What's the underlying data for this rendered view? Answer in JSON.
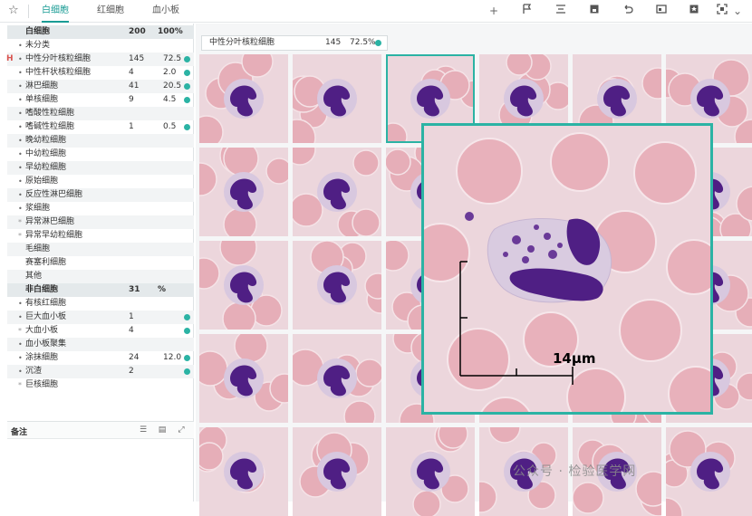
{
  "toolbar": {
    "tabs": [
      {
        "label": "白细胞",
        "active": true
      },
      {
        "label": "红细胞",
        "active": false
      },
      {
        "label": "血小板",
        "active": false
      }
    ],
    "icons": [
      "star-icon",
      "plus-icon",
      "flag-icon",
      "align-icon",
      "save-icon",
      "undo-icon",
      "gallery-icon",
      "bookmark-icon",
      "fit-icon",
      "chevron-down-icon"
    ]
  },
  "wbc_panel": {
    "header": {
      "label": "白细胞",
      "count": "200",
      "percent": "100%"
    },
    "items": [
      {
        "label": "未分类",
        "count": "",
        "percent": "",
        "dot": false,
        "star": false
      },
      {
        "label": "中性分叶核粒细胞",
        "count": "145",
        "percent": "72.5",
        "dot": true,
        "star": false,
        "flag": "H"
      },
      {
        "label": "中性杆状核粒细胞",
        "count": "4",
        "percent": "2.0",
        "dot": true,
        "star": false
      },
      {
        "label": "淋巴细胞",
        "count": "41",
        "percent": "20.5",
        "dot": true,
        "star": false
      },
      {
        "label": "单核细胞",
        "count": "9",
        "percent": "4.5",
        "dot": true,
        "star": false
      },
      {
        "label": "嗜酸性粒细胞",
        "count": "",
        "percent": "",
        "dot": false,
        "star": false
      },
      {
        "label": "嗜碱性粒细胞",
        "count": "1",
        "percent": "0.5",
        "dot": true,
        "star": false
      },
      {
        "label": "晚幼粒细胞",
        "count": "",
        "percent": "",
        "dot": false,
        "star": false
      },
      {
        "label": "中幼粒细胞",
        "count": "",
        "percent": "",
        "dot": false,
        "star": false
      },
      {
        "label": "早幼粒细胞",
        "count": "",
        "percent": "",
        "dot": false,
        "star": false
      },
      {
        "label": "原始细胞",
        "count": "",
        "percent": "",
        "dot": false,
        "star": false
      },
      {
        "label": "反应性淋巴细胞",
        "count": "",
        "percent": "",
        "dot": false,
        "star": false
      },
      {
        "label": "浆细胞",
        "count": "",
        "percent": "",
        "dot": false,
        "star": false
      },
      {
        "label": "异常淋巴细胞",
        "count": "",
        "percent": "",
        "dot": false,
        "star": true
      },
      {
        "label": "异常早幼粒细胞",
        "count": "",
        "percent": "",
        "dot": false,
        "star": true
      },
      {
        "label": "毛细胞",
        "count": "",
        "percent": "",
        "dot": false,
        "star": false,
        "nobullet": true
      },
      {
        "label": "赛塞利细胞",
        "count": "",
        "percent": "",
        "dot": false,
        "star": false,
        "nobullet": true
      },
      {
        "label": "其他",
        "count": "",
        "percent": "",
        "dot": false,
        "star": false,
        "nobullet": true
      }
    ]
  },
  "non_wbc_panel": {
    "header": {
      "label": "非白细胞",
      "count": "31",
      "percent": "%"
    },
    "items": [
      {
        "label": "有核红细胞",
        "count": "",
        "percent": "",
        "dot": false,
        "star": false
      },
      {
        "label": "巨大血小板",
        "count": "1",
        "percent": "",
        "dot": true,
        "star": false
      },
      {
        "label": "大血小板",
        "count": "4",
        "percent": "",
        "dot": true,
        "star": true
      },
      {
        "label": "血小板聚集",
        "count": "",
        "percent": "",
        "dot": false,
        "star": false
      },
      {
        "label": "涂抹细胞",
        "count": "24",
        "percent": "12.0",
        "dot": true,
        "star": false
      },
      {
        "label": "沉渣",
        "count": "2",
        "percent": "",
        "dot": true,
        "star": false
      },
      {
        "label": "巨核细胞",
        "count": "",
        "percent": "",
        "dot": false,
        "star": true
      }
    ]
  },
  "notes": {
    "label": "备注"
  },
  "selected_category": {
    "label": "中性分叶核粒细胞",
    "count": "145",
    "percent": "72.5%"
  },
  "zoom": {
    "scale_label": "14μm"
  },
  "watermark": "公众号 · 检验医学网",
  "colors": {
    "accent": "#2bb3a4",
    "flag": "#d9534f",
    "cell_bg": "#ecd6dc",
    "rbc": "#e6aeb8",
    "nucleus": "#5a2a86"
  }
}
